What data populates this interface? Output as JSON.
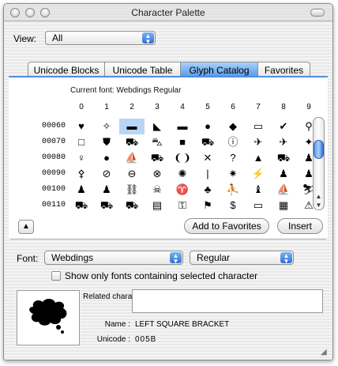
{
  "window": {
    "title": "Character Palette"
  },
  "view": {
    "label": "View:",
    "value": "All"
  },
  "tabs": [
    {
      "label": "Unicode Blocks",
      "active": false
    },
    {
      "label": "Unicode Table",
      "active": false
    },
    {
      "label": "Glyph Catalog",
      "active": true
    },
    {
      "label": "Favorites",
      "active": false
    }
  ],
  "catalog": {
    "current_font": "Current font: Webdings Regular",
    "columns": [
      "0",
      "1",
      "2",
      "3",
      "4",
      "5",
      "6",
      "7",
      "8",
      "9"
    ],
    "rows": [
      {
        "label": "00060",
        "glyphs": [
          "♥",
          "✧",
          "▬",
          "◣",
          "▬",
          "●",
          "◆",
          "▭",
          "✔",
          "⚲"
        ]
      },
      {
        "label": "00070",
        "glyphs": [
          "□",
          "⛊",
          "⛟",
          "⛍",
          "■",
          "⛟",
          "ⓘ",
          "✈",
          "✈",
          "✦"
        ]
      },
      {
        "label": "00080",
        "glyphs": [
          "♀",
          "●",
          "⛵",
          "⛟",
          "❨❩",
          "✕",
          "?",
          "▲",
          "⛟",
          "♟"
        ]
      },
      {
        "label": "00090",
        "glyphs": [
          "⚴",
          "⊘",
          "⊖",
          "⊗",
          "✺",
          "|",
          "✷",
          "⚡",
          "♟",
          "♟"
        ]
      },
      {
        "label": "00100",
        "glyphs": [
          "♟",
          "♟",
          "⛓",
          "☠",
          "♈",
          "♣",
          "⛹",
          "♝",
          "⛵",
          "⛷"
        ]
      },
      {
        "label": "00110",
        "glyphs": [
          "⛟",
          "⛟",
          "⛟",
          "▤",
          "⚿",
          "⚑",
          "$",
          "▭",
          "▦",
          "⚠"
        ]
      }
    ],
    "selected": {
      "row": 0,
      "col": 2
    }
  },
  "buttons": {
    "expand": "▲",
    "add_favorites": "Add to Favorites",
    "insert": "Insert"
  },
  "font": {
    "label": "Font:",
    "family": "Webdings",
    "style": "Regular"
  },
  "show_fonts_checkbox": {
    "label": "Show only fonts containing selected character",
    "checked": false
  },
  "info": {
    "related_label": "Related characters :",
    "name_label": "Name :",
    "name_value": "LEFT SQUARE BRACKET",
    "unicode_label": "Unicode :",
    "unicode_value": "005B"
  },
  "colors": {
    "accent": "#4f94e8",
    "selection": "#b9d5f5"
  }
}
